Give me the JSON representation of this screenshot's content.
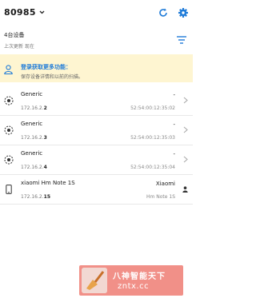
{
  "header": {
    "wifi_name": "80985",
    "refresh_icon": "refresh-icon",
    "settings_icon": "gear-icon"
  },
  "summary": {
    "device_count": "4台设备",
    "last_updated": "上次更新 现在"
  },
  "banner": {
    "title": "登录获取更多功能：",
    "subtitle": "保存设备详情和以前的扫描。"
  },
  "devices": [
    {
      "name": "Generic",
      "ip_prefix": "172.16.2.",
      "ip_suffix": "2",
      "right_top": "-",
      "mac": "52:54:00:12:35:02",
      "icon": "router-icon"
    },
    {
      "name": "Generic",
      "ip_prefix": "172.16.2.",
      "ip_suffix": "3",
      "right_top": "-",
      "mac": "52:54:00:12:35:03",
      "icon": "router-icon"
    },
    {
      "name": "Generic",
      "ip_prefix": "172.16.2.",
      "ip_suffix": "4",
      "right_top": "-",
      "mac": "52:54:00:12:35:04",
      "icon": "router-icon"
    },
    {
      "name": "xiaomi Hm Note 1S",
      "ip_prefix": "172.16.2.",
      "ip_suffix": "15",
      "right_top": "Xiaomi",
      "mac": "Hm Note 1S",
      "icon": "phone-icon"
    }
  ],
  "watermark": {
    "line1": "八神智能天下",
    "line2": "zntx.cc"
  },
  "colors": {
    "accent": "#1f7bd8",
    "banner_bg": "#fef5d1"
  }
}
